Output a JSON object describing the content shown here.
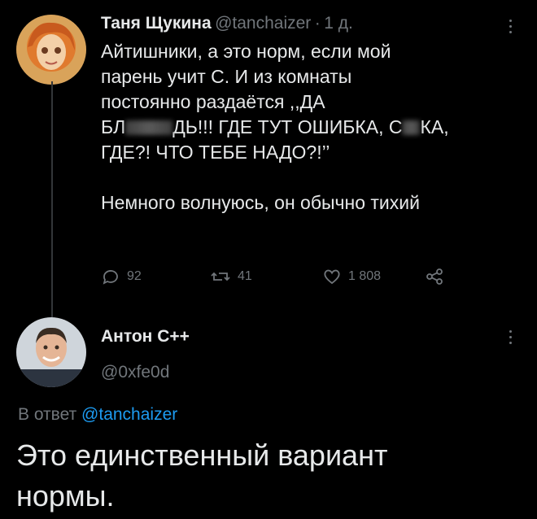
{
  "tweet": {
    "author_name": "Таня Щукина",
    "handle": "@tanchaizer",
    "sep": "·",
    "time": "1 д.",
    "lines": [
      "Айтишники, а это норм, если мой",
      "парень учит С. И из комнаты",
      "постоянно раздаётся ,,ДА"
    ],
    "line4_a": "БЛ",
    "line4_b": "ДЬ!!! ГДЕ ТУТ ОШИБКА, С",
    "line4_c": "КА,",
    "line5": "ГДЕ?! ЧТО ТЕБЕ НАДО?!’’",
    "line6": "Немного волнуюсь, он обычно тихий",
    "replies": "92",
    "retweets": "41",
    "likes": "1 808"
  },
  "reply": {
    "author_name": "Антон С++",
    "handle": "@0xfe0d",
    "context_prefix": "В ответ",
    "context_handle": "@tanchaizer",
    "text_line1": "Это единственный вариант",
    "text_line2": "нормы."
  },
  "colors": {
    "background": "#000000",
    "text": "#e7e9ea",
    "muted": "#71767b",
    "link": "#1d9bf0"
  }
}
